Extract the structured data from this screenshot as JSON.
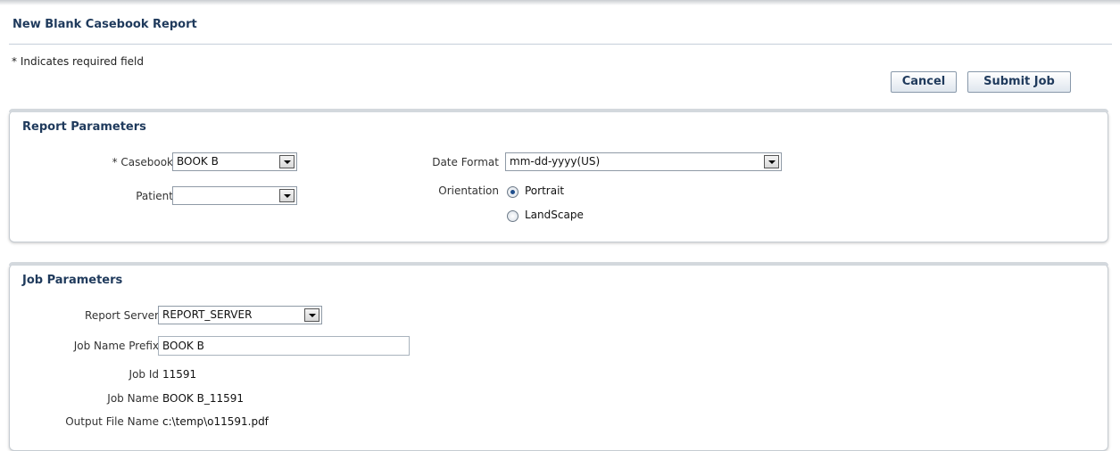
{
  "page": {
    "title": "New Blank Casebook Report",
    "required_note": "* Indicates required field"
  },
  "actions": {
    "cancel_label": "Cancel",
    "submit_label": "Submit Job"
  },
  "report_parameters": {
    "title": "Report Parameters",
    "casebook": {
      "label": "* Casebook",
      "value": "BOOK B"
    },
    "patient": {
      "label": "Patient",
      "value": ""
    },
    "date_format": {
      "label": "Date Format",
      "value": "mm-dd-yyyy(US)"
    },
    "orientation": {
      "label": "Orientation",
      "options": [
        "Portrait",
        "LandScape"
      ],
      "selected": "Portrait"
    }
  },
  "job_parameters": {
    "title": "Job Parameters",
    "report_server": {
      "label": "Report Server",
      "value": "REPORT_SERVER"
    },
    "job_name_prefix": {
      "label": "Job Name Prefix",
      "value": "BOOK B"
    },
    "job_id": {
      "label": "Job Id",
      "value": "11591"
    },
    "job_name": {
      "label": "Job Name",
      "value": "BOOK B_11591"
    },
    "output_file_name": {
      "label": "Output File Name",
      "value": "c:\\temp\\o11591.pdf"
    }
  },
  "colors": {
    "heading": "#1f3a5c",
    "radio_selected": "#1f4e8c"
  }
}
